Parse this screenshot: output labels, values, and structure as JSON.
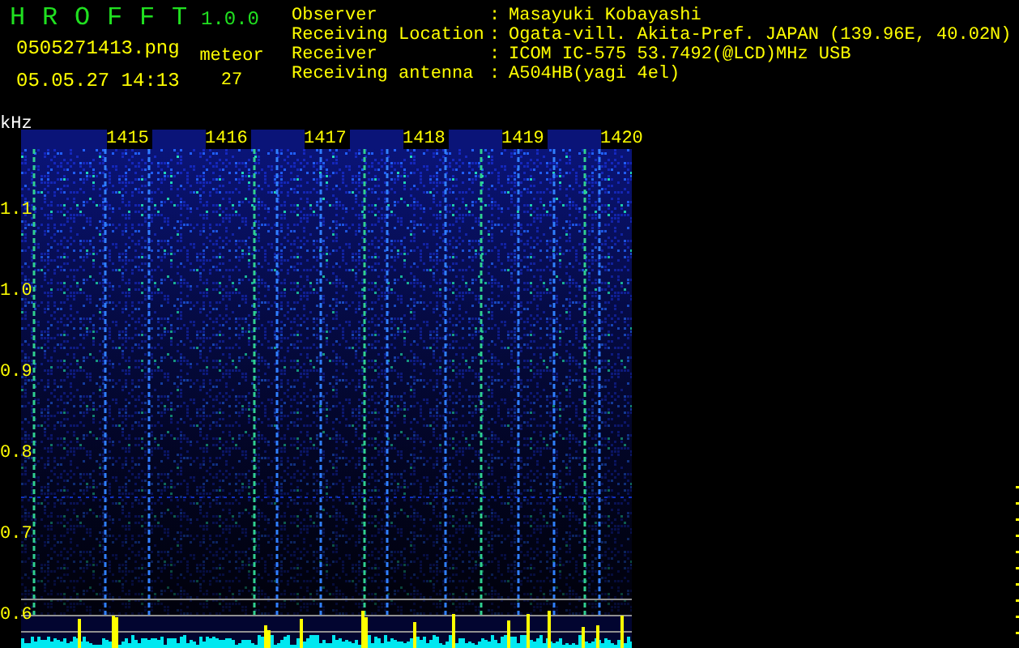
{
  "app": {
    "title_letters": [
      "H",
      "R",
      "O",
      "F",
      "F",
      "T"
    ],
    "version": "1.0.0"
  },
  "file_name": "0505271413.png",
  "date_time": "05.05.27 14:13",
  "meteor": {
    "label": "meteor",
    "count": "27"
  },
  "info": [
    {
      "label": "Observer",
      "sep": ":",
      "value": "Masayuki Kobayashi"
    },
    {
      "label": "Receiving Location",
      "sep": ":",
      "value": "Ogata-vill. Akita-Pref. JAPAN (139.96E, 40.02N)"
    },
    {
      "label": "Receiver",
      "sep": ":",
      "value": "ICOM IC-575 53.7492(@LCD)MHz USB"
    },
    {
      "label": "Receiving antenna",
      "sep": ":",
      "value": "A504HB(yagi 4el)"
    }
  ],
  "y_unit": "kHz",
  "y_labels": [
    "1.1",
    "1.0",
    "0.9",
    "0.8",
    "0.7",
    "0.6"
  ],
  "x_labels": [
    "1415",
    "1416",
    "1417",
    "1418",
    "1419",
    "1420"
  ]
}
